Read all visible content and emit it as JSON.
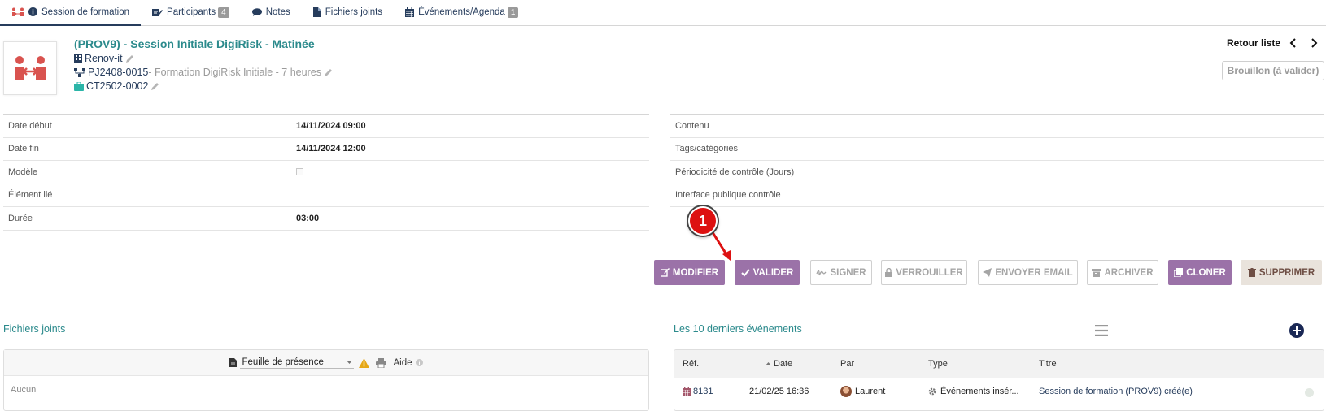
{
  "tabs": [
    {
      "label": "Session de formation",
      "badge": ""
    },
    {
      "label": "Participants",
      "badge": "4"
    },
    {
      "label": "Notes",
      "badge": ""
    },
    {
      "label": "Fichiers joints",
      "badge": ""
    },
    {
      "label": "Événements/Agenda",
      "badge": "1"
    }
  ],
  "header": {
    "title": "(PROV9) - Session Initiale DigiRisk - Matinée",
    "company": "Renov-it",
    "project_ref": "PJ2408-0015",
    "project_label": " - Formation DigiRisk Initiale - 7 heures",
    "contract": "CT2502-0002",
    "back_label": "Retour liste",
    "status": "Brouillon (à valider)"
  },
  "fields_left": [
    {
      "label": "Date début",
      "value": "14/11/2024 09:00"
    },
    {
      "label": "Date fin",
      "value": "14/11/2024 12:00"
    },
    {
      "label": "Modèle",
      "value": ""
    },
    {
      "label": "Élément lié",
      "value": ""
    },
    {
      "label": "Durée",
      "value": "03:00"
    }
  ],
  "fields_right": [
    {
      "label": "Contenu"
    },
    {
      "label": "Tags/catégories"
    },
    {
      "label": "Périodicité de contrôle (Jours)"
    },
    {
      "label": "Interface publique contrôle"
    }
  ],
  "actions": {
    "modifier": "MODIFIER",
    "valider": "VALIDER",
    "signer": "SIGNER",
    "verrouiller": "VERROUILLER",
    "envoyer": "ENVOYER EMAIL",
    "archiver": "ARCHIVER",
    "cloner": "CLONER",
    "supprimer": "SUPPRIMER"
  },
  "annotation": {
    "number": "1",
    "color": "#dd1111"
  },
  "files": {
    "title": "Fichiers joints",
    "model_selected": "Feuille de présence",
    "help": "Aide",
    "empty": "Aucun"
  },
  "events": {
    "title": "Les 10 derniers événements",
    "columns": [
      "Réf.",
      "Date",
      "Par",
      "Type",
      "Titre"
    ],
    "rows": [
      {
        "ref": "8131",
        "date": "21/02/25 16:36",
        "by": "Laurent",
        "type": "Événements insér...",
        "title": "Session de formation (PROV9) créé(e)"
      }
    ]
  },
  "colors": {
    "accent": "#9b72a8",
    "link": "#263c5c",
    "teal": "#2b8a8c"
  }
}
